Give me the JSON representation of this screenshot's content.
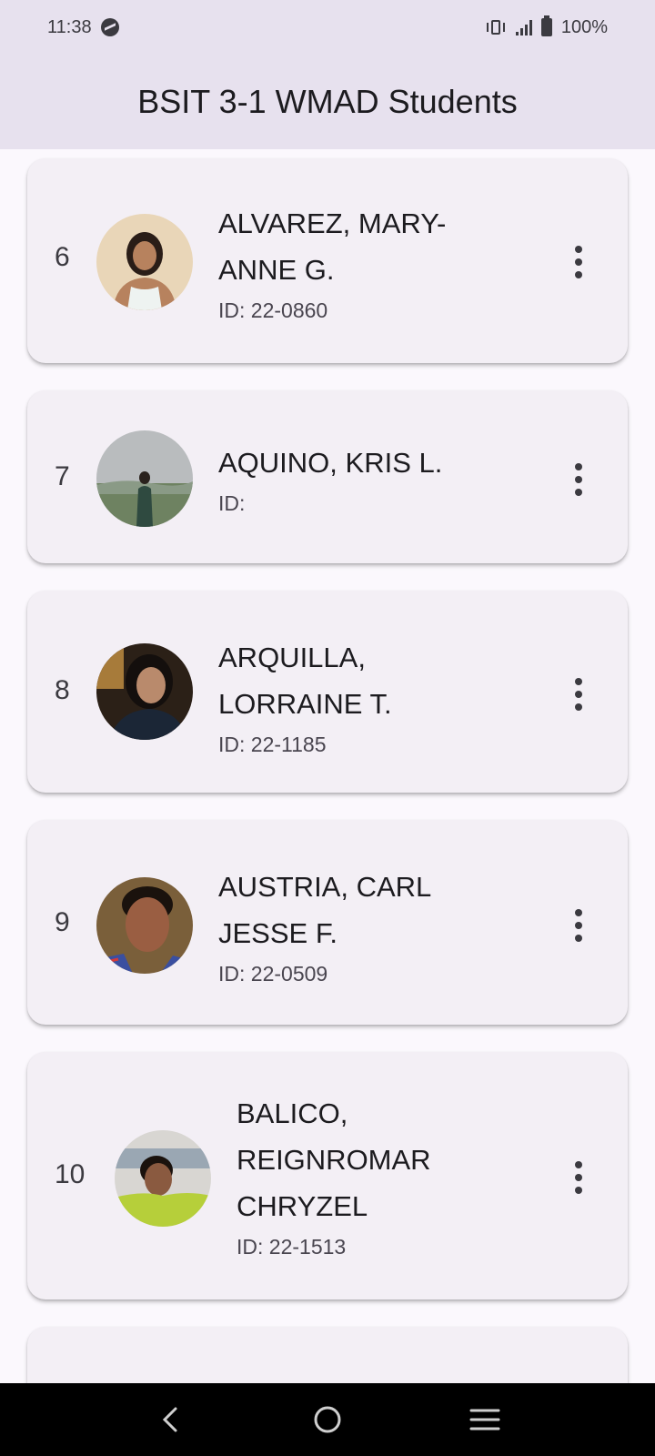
{
  "status_bar": {
    "time": "11:38",
    "battery": "100%"
  },
  "app_bar": {
    "title": "BSIT 3-1 WMAD Students"
  },
  "students": [
    {
      "number": "6",
      "name": "ALVAREZ, MARY-ANNE G.",
      "name_lines": [
        "ALVAREZ, MARY-",
        "ANNE G."
      ],
      "id": "ID: 22-0860"
    },
    {
      "number": "7",
      "name": "AQUINO, KRIS L.",
      "name_lines": [
        "AQUINO, KRIS L."
      ],
      "id": "ID:"
    },
    {
      "number": "8",
      "name": "ARQUILLA, LORRAINE T.",
      "name_lines": [
        "ARQUILLA,",
        "LORRAINE T."
      ],
      "id": "ID: 22-1185"
    },
    {
      "number": "9",
      "name": "AUSTRIA, CARL JESSE F.",
      "name_lines": [
        "AUSTRIA, CARL",
        "JESSE F."
      ],
      "id": "ID: 22-0509"
    },
    {
      "number": "10",
      "name": "BALICO, REIGNROMAR CHRYZEL",
      "name_lines": [
        "BALICO,",
        "REIGNROMAR",
        "CHRYZEL"
      ],
      "id": "ID: 22-1513"
    }
  ],
  "colors": {
    "app_bar_bg": "#e7e1ee",
    "card_bg": "#f3eff5",
    "page_bg": "#fbf8fd"
  }
}
